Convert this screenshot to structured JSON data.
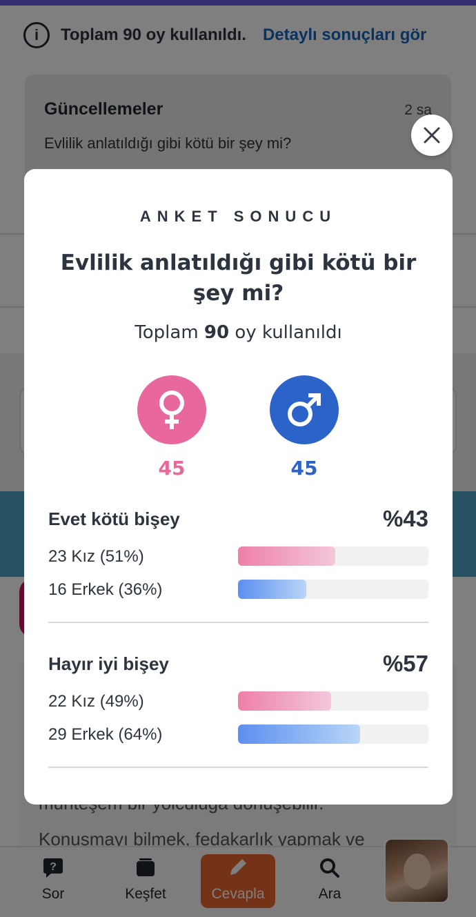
{
  "background": {
    "info": {
      "icon": "info-icon",
      "text": "Toplam 90 oy kullanıldı.",
      "link": "Detaylı sonuçları gör"
    },
    "updates": {
      "title": "Güncellemeler",
      "time": "2 sa",
      "question": "Evlilik anlatıldığı gibi kötü bir şey mi?"
    },
    "body_text": [
      "muhteşem bir yolculuğa dönüşebilir.",
      "Konuşmayı bilmek, fedakarlık yapmak ve"
    ],
    "nav": [
      {
        "label": "Sor",
        "icon": "ask-icon"
      },
      {
        "label": "Keşfet",
        "icon": "explore-icon"
      },
      {
        "label": "Cevapla",
        "icon": "pencil-icon"
      },
      {
        "label": "Ara",
        "icon": "search-icon"
      }
    ]
  },
  "modal": {
    "eyebrow": "ANKET SONUCU",
    "question": "Evlilik anlatıldığı gibi kötü bir şey mi?",
    "total_prefix": "Toplam",
    "total_count": "90",
    "total_suffix": "oy kullanıldı",
    "female_count": "45",
    "male_count": "45",
    "options": [
      {
        "label": "Evet kötü bişey",
        "percent": "%43",
        "female_label": "23 Kız (51%)",
        "female_share": 51,
        "male_label": "16 Erkek (36%)",
        "male_share": 36
      },
      {
        "label": "Hayır iyi bişey",
        "percent": "%57",
        "female_label": "22 Kız (49%)",
        "female_share": 49,
        "male_label": "29 Erkek (64%)",
        "male_share": 64
      }
    ]
  },
  "colors": {
    "female": "#e8679c",
    "male": "#2c63c8",
    "accent": "#e8652c",
    "link": "#1565c0"
  }
}
